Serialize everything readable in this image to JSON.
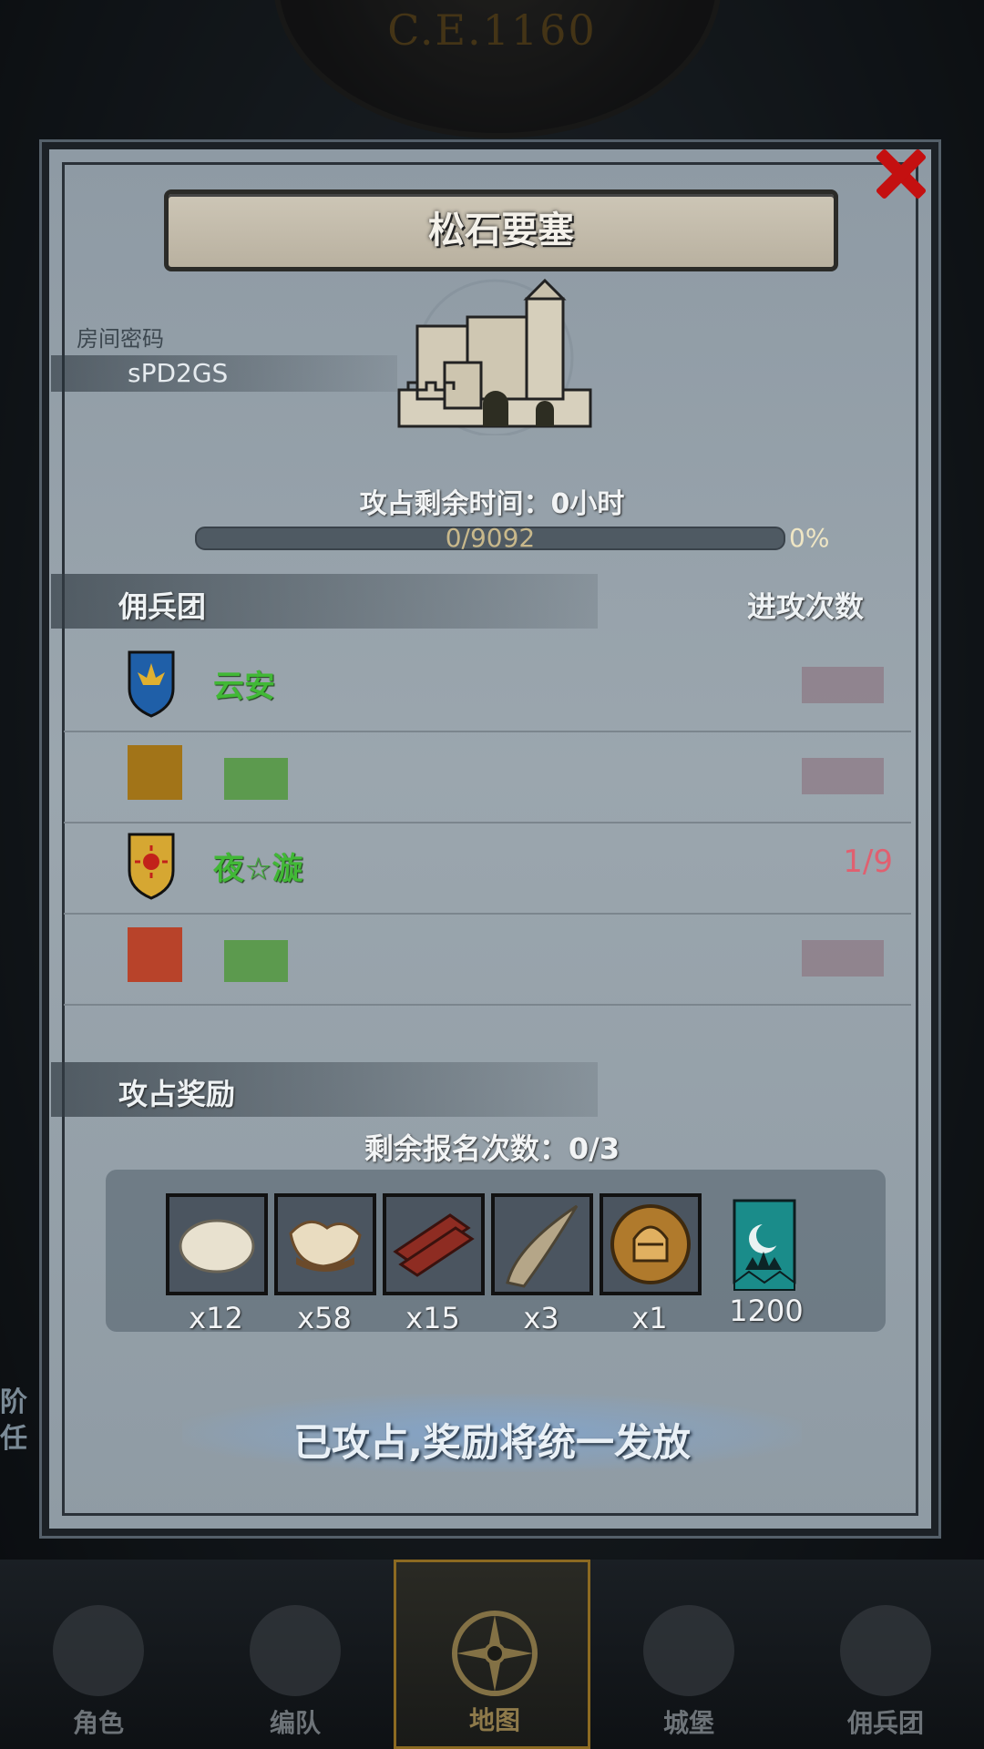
{
  "header": {
    "year": "C.E.1160"
  },
  "dialog": {
    "title": "松石要塞",
    "room_label": "房间密码",
    "room_code": "sPD2GS",
    "time_text": "攻占剩余时间：0小时",
    "progress": {
      "text": "0/9092",
      "percent_text": "0%",
      "value": 0
    },
    "mercenary_header": "佣兵团",
    "attack_header": "进攻次数",
    "rows": [
      {
        "name": "云安",
        "count": "",
        "shield": "blue-fleur-shield-icon"
      },
      {
        "name": "",
        "count": "",
        "shield": "orange-shield-icon"
      },
      {
        "name": "夜☆漩",
        "count": "1/9",
        "shield": "sun-shield-icon"
      },
      {
        "name": "",
        "count": "",
        "shield": "red-shield-icon"
      }
    ],
    "reward_label": "攻占奖励",
    "remain_text": "剩余报名次数：0/3",
    "rewards": [
      {
        "icon": "fur-icon",
        "qty": "x12"
      },
      {
        "icon": "leather-icon",
        "qty": "x58"
      },
      {
        "icon": "wood-planks-icon",
        "qty": "x15"
      },
      {
        "icon": "horn-icon",
        "qty": "x3"
      },
      {
        "icon": "knight-helmet-coin-icon",
        "qty": "x1"
      },
      {
        "icon": "banner-icon",
        "qty": "1200"
      }
    ],
    "status_text": "已攻占,奖励将统一发放"
  },
  "side": {
    "line1": "阶",
    "line2": "任"
  },
  "nav": [
    {
      "label": "角色",
      "icon": "knight-icon"
    },
    {
      "label": "编队",
      "icon": "helmet-icon"
    },
    {
      "label": "地图",
      "icon": "compass-icon",
      "active": true
    },
    {
      "label": "城堡",
      "icon": "castle-icon"
    },
    {
      "label": "佣兵团",
      "icon": "mercenary-icon"
    }
  ],
  "colors": {
    "accent_green": "#41b836",
    "count_red": "#e06070",
    "close_red": "#c41010",
    "nav_active": "#8c6a21"
  }
}
